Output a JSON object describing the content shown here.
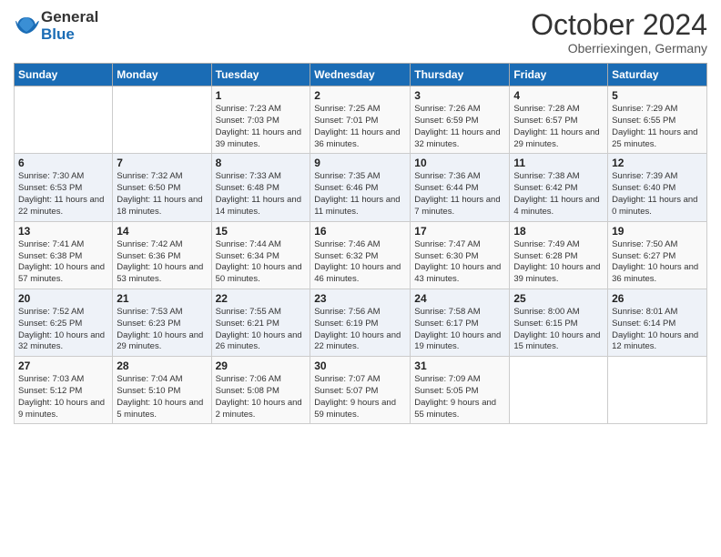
{
  "logo": {
    "general": "General",
    "blue": "Blue"
  },
  "title": {
    "month": "October 2024",
    "location": "Oberriexingen, Germany"
  },
  "weekdays": [
    "Sunday",
    "Monday",
    "Tuesday",
    "Wednesday",
    "Thursday",
    "Friday",
    "Saturday"
  ],
  "weeks": [
    [
      {
        "day": "",
        "detail": ""
      },
      {
        "day": "",
        "detail": ""
      },
      {
        "day": "1",
        "detail": "Sunrise: 7:23 AM\nSunset: 7:03 PM\nDaylight: 11 hours and 39 minutes."
      },
      {
        "day": "2",
        "detail": "Sunrise: 7:25 AM\nSunset: 7:01 PM\nDaylight: 11 hours and 36 minutes."
      },
      {
        "day": "3",
        "detail": "Sunrise: 7:26 AM\nSunset: 6:59 PM\nDaylight: 11 hours and 32 minutes."
      },
      {
        "day": "4",
        "detail": "Sunrise: 7:28 AM\nSunset: 6:57 PM\nDaylight: 11 hours and 29 minutes."
      },
      {
        "day": "5",
        "detail": "Sunrise: 7:29 AM\nSunset: 6:55 PM\nDaylight: 11 hours and 25 minutes."
      }
    ],
    [
      {
        "day": "6",
        "detail": "Sunrise: 7:30 AM\nSunset: 6:53 PM\nDaylight: 11 hours and 22 minutes."
      },
      {
        "day": "7",
        "detail": "Sunrise: 7:32 AM\nSunset: 6:50 PM\nDaylight: 11 hours and 18 minutes."
      },
      {
        "day": "8",
        "detail": "Sunrise: 7:33 AM\nSunset: 6:48 PM\nDaylight: 11 hours and 14 minutes."
      },
      {
        "day": "9",
        "detail": "Sunrise: 7:35 AM\nSunset: 6:46 PM\nDaylight: 11 hours and 11 minutes."
      },
      {
        "day": "10",
        "detail": "Sunrise: 7:36 AM\nSunset: 6:44 PM\nDaylight: 11 hours and 7 minutes."
      },
      {
        "day": "11",
        "detail": "Sunrise: 7:38 AM\nSunset: 6:42 PM\nDaylight: 11 hours and 4 minutes."
      },
      {
        "day": "12",
        "detail": "Sunrise: 7:39 AM\nSunset: 6:40 PM\nDaylight: 11 hours and 0 minutes."
      }
    ],
    [
      {
        "day": "13",
        "detail": "Sunrise: 7:41 AM\nSunset: 6:38 PM\nDaylight: 10 hours and 57 minutes."
      },
      {
        "day": "14",
        "detail": "Sunrise: 7:42 AM\nSunset: 6:36 PM\nDaylight: 10 hours and 53 minutes."
      },
      {
        "day": "15",
        "detail": "Sunrise: 7:44 AM\nSunset: 6:34 PM\nDaylight: 10 hours and 50 minutes."
      },
      {
        "day": "16",
        "detail": "Sunrise: 7:46 AM\nSunset: 6:32 PM\nDaylight: 10 hours and 46 minutes."
      },
      {
        "day": "17",
        "detail": "Sunrise: 7:47 AM\nSunset: 6:30 PM\nDaylight: 10 hours and 43 minutes."
      },
      {
        "day": "18",
        "detail": "Sunrise: 7:49 AM\nSunset: 6:28 PM\nDaylight: 10 hours and 39 minutes."
      },
      {
        "day": "19",
        "detail": "Sunrise: 7:50 AM\nSunset: 6:27 PM\nDaylight: 10 hours and 36 minutes."
      }
    ],
    [
      {
        "day": "20",
        "detail": "Sunrise: 7:52 AM\nSunset: 6:25 PM\nDaylight: 10 hours and 32 minutes."
      },
      {
        "day": "21",
        "detail": "Sunrise: 7:53 AM\nSunset: 6:23 PM\nDaylight: 10 hours and 29 minutes."
      },
      {
        "day": "22",
        "detail": "Sunrise: 7:55 AM\nSunset: 6:21 PM\nDaylight: 10 hours and 26 minutes."
      },
      {
        "day": "23",
        "detail": "Sunrise: 7:56 AM\nSunset: 6:19 PM\nDaylight: 10 hours and 22 minutes."
      },
      {
        "day": "24",
        "detail": "Sunrise: 7:58 AM\nSunset: 6:17 PM\nDaylight: 10 hours and 19 minutes."
      },
      {
        "day": "25",
        "detail": "Sunrise: 8:00 AM\nSunset: 6:15 PM\nDaylight: 10 hours and 15 minutes."
      },
      {
        "day": "26",
        "detail": "Sunrise: 8:01 AM\nSunset: 6:14 PM\nDaylight: 10 hours and 12 minutes."
      }
    ],
    [
      {
        "day": "27",
        "detail": "Sunrise: 7:03 AM\nSunset: 5:12 PM\nDaylight: 10 hours and 9 minutes."
      },
      {
        "day": "28",
        "detail": "Sunrise: 7:04 AM\nSunset: 5:10 PM\nDaylight: 10 hours and 5 minutes."
      },
      {
        "day": "29",
        "detail": "Sunrise: 7:06 AM\nSunset: 5:08 PM\nDaylight: 10 hours and 2 minutes."
      },
      {
        "day": "30",
        "detail": "Sunrise: 7:07 AM\nSunset: 5:07 PM\nDaylight: 9 hours and 59 minutes."
      },
      {
        "day": "31",
        "detail": "Sunrise: 7:09 AM\nSunset: 5:05 PM\nDaylight: 9 hours and 55 minutes."
      },
      {
        "day": "",
        "detail": ""
      },
      {
        "day": "",
        "detail": ""
      }
    ]
  ]
}
